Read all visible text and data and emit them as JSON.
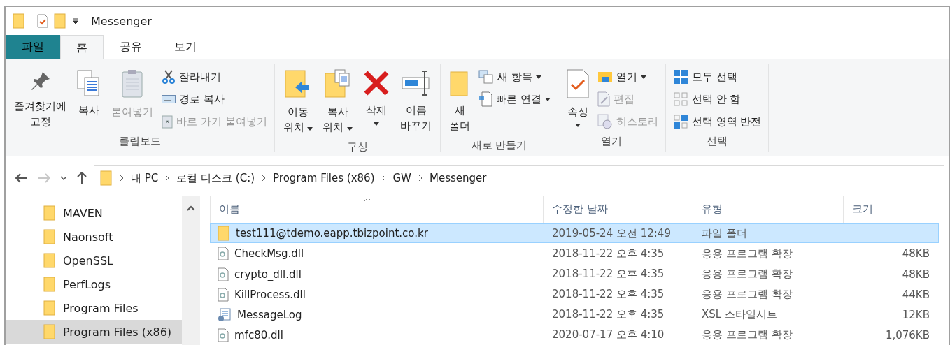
{
  "title_bar": {
    "title": "Messenger"
  },
  "tabs": [
    {
      "label": "파일",
      "kind": "file",
      "selected": false
    },
    {
      "label": "홈",
      "kind": "tab",
      "selected": true
    },
    {
      "label": "공유",
      "kind": "tab",
      "selected": false
    },
    {
      "label": "보기",
      "kind": "tab",
      "selected": false
    }
  ],
  "ribbon": {
    "groups": [
      {
        "label": "클립보드",
        "items": [
          {
            "kind": "large",
            "label": "즐겨찾기에\n고정",
            "disabled": false,
            "dropdown": false
          },
          {
            "kind": "large",
            "label": "복사",
            "disabled": false,
            "dropdown": false
          },
          {
            "kind": "large",
            "label": "붙여넣기",
            "disabled": true,
            "dropdown": false
          },
          {
            "kind": "small",
            "label": "잘라내기",
            "disabled": false,
            "dropdown": false
          },
          {
            "kind": "small",
            "label": "경로 복사",
            "disabled": false,
            "dropdown": false
          },
          {
            "kind": "small",
            "label": "바로 가기 붙여넣기",
            "disabled": true,
            "dropdown": false
          }
        ]
      },
      {
        "label": "구성",
        "items": [
          {
            "kind": "large",
            "label": "이동\n위치",
            "disabled": false,
            "dropdown": true
          },
          {
            "kind": "large",
            "label": "복사\n위치",
            "disabled": false,
            "dropdown": true
          },
          {
            "kind": "large",
            "label": "삭제",
            "disabled": false,
            "dropdown": true
          },
          {
            "kind": "large",
            "label": "이름\n바꾸기",
            "disabled": false,
            "dropdown": false
          }
        ]
      },
      {
        "label": "새로 만들기",
        "items": [
          {
            "kind": "large",
            "label": "새\n폴더",
            "disabled": false,
            "dropdown": false
          },
          {
            "kind": "small",
            "label": "새 항목",
            "disabled": false,
            "dropdown": true
          },
          {
            "kind": "small",
            "label": "빠른 연결",
            "disabled": false,
            "dropdown": true
          }
        ]
      },
      {
        "label": "열기",
        "items": [
          {
            "kind": "large",
            "label": "속성",
            "disabled": false,
            "dropdown": true
          },
          {
            "kind": "small",
            "label": "열기",
            "disabled": false,
            "dropdown": true
          },
          {
            "kind": "small",
            "label": "편집",
            "disabled": true,
            "dropdown": false
          },
          {
            "kind": "small",
            "label": "히스토리",
            "disabled": true,
            "dropdown": false
          }
        ]
      },
      {
        "label": "선택",
        "items": [
          {
            "kind": "small",
            "label": "모두 선택",
            "disabled": false,
            "dropdown": false
          },
          {
            "kind": "small",
            "label": "선택 안 함",
            "disabled": false,
            "dropdown": false
          },
          {
            "kind": "small",
            "label": "선택 영역 반전",
            "disabled": false,
            "dropdown": false
          }
        ]
      }
    ]
  },
  "address_bar": {
    "nav": [
      {
        "kind": "back",
        "disabled": false
      },
      {
        "kind": "forward",
        "disabled": true
      },
      {
        "kind": "recent",
        "disabled": false
      },
      {
        "kind": "up",
        "disabled": false
      }
    ],
    "path": [
      "내 PC",
      "로컬 디스크 (C:)",
      "Program Files (x86)",
      "GW",
      "Messenger"
    ]
  },
  "sidebar": {
    "items": [
      {
        "label": "MAVEN",
        "selected": false
      },
      {
        "label": "Naonsoft",
        "selected": false
      },
      {
        "label": "OpenSSL",
        "selected": false
      },
      {
        "label": "PerfLogs",
        "selected": false
      },
      {
        "label": "Program Files",
        "selected": false
      },
      {
        "label": "Program Files (x86)",
        "selected": true
      }
    ]
  },
  "file_list": {
    "columns": [
      "이름",
      "수정한 날짜",
      "유형",
      "크기"
    ],
    "rows": [
      {
        "kind": "folder",
        "name": "test111@tdemo.eapp.tbizpoint.co.kr",
        "date": "2019-05-24 오전 12:49",
        "type": "파일 폴더",
        "selected": true
      },
      {
        "kind": "dll",
        "name": "CheckMsg.dll",
        "date": "2018-11-22 오후 4:35",
        "type": "응용 프로그램 확장",
        "size": "48KB",
        "selected": false
      },
      {
        "kind": "dll",
        "name": "crypto_dll.dll",
        "date": "2018-11-22 오후 4:35",
        "type": "응용 프로그램 확장",
        "size": "48KB",
        "selected": false
      },
      {
        "kind": "dll",
        "name": "KillProcess.dll",
        "date": "2018-11-22 오후 4:35",
        "type": "응용 프로그램 확장",
        "size": "44KB",
        "selected": false
      },
      {
        "kind": "xsl",
        "name": "MessageLog",
        "date": "2018-11-22 오후 4:35",
        "type": "XSL 스타일시트",
        "size": "12KB",
        "selected": false
      },
      {
        "kind": "dll",
        "name": "mfc80.dll",
        "date": "2020-07-17 오후 4:10",
        "type": "응용 프로그램 확장",
        "size": "1,076KB",
        "selected": false
      }
    ]
  }
}
